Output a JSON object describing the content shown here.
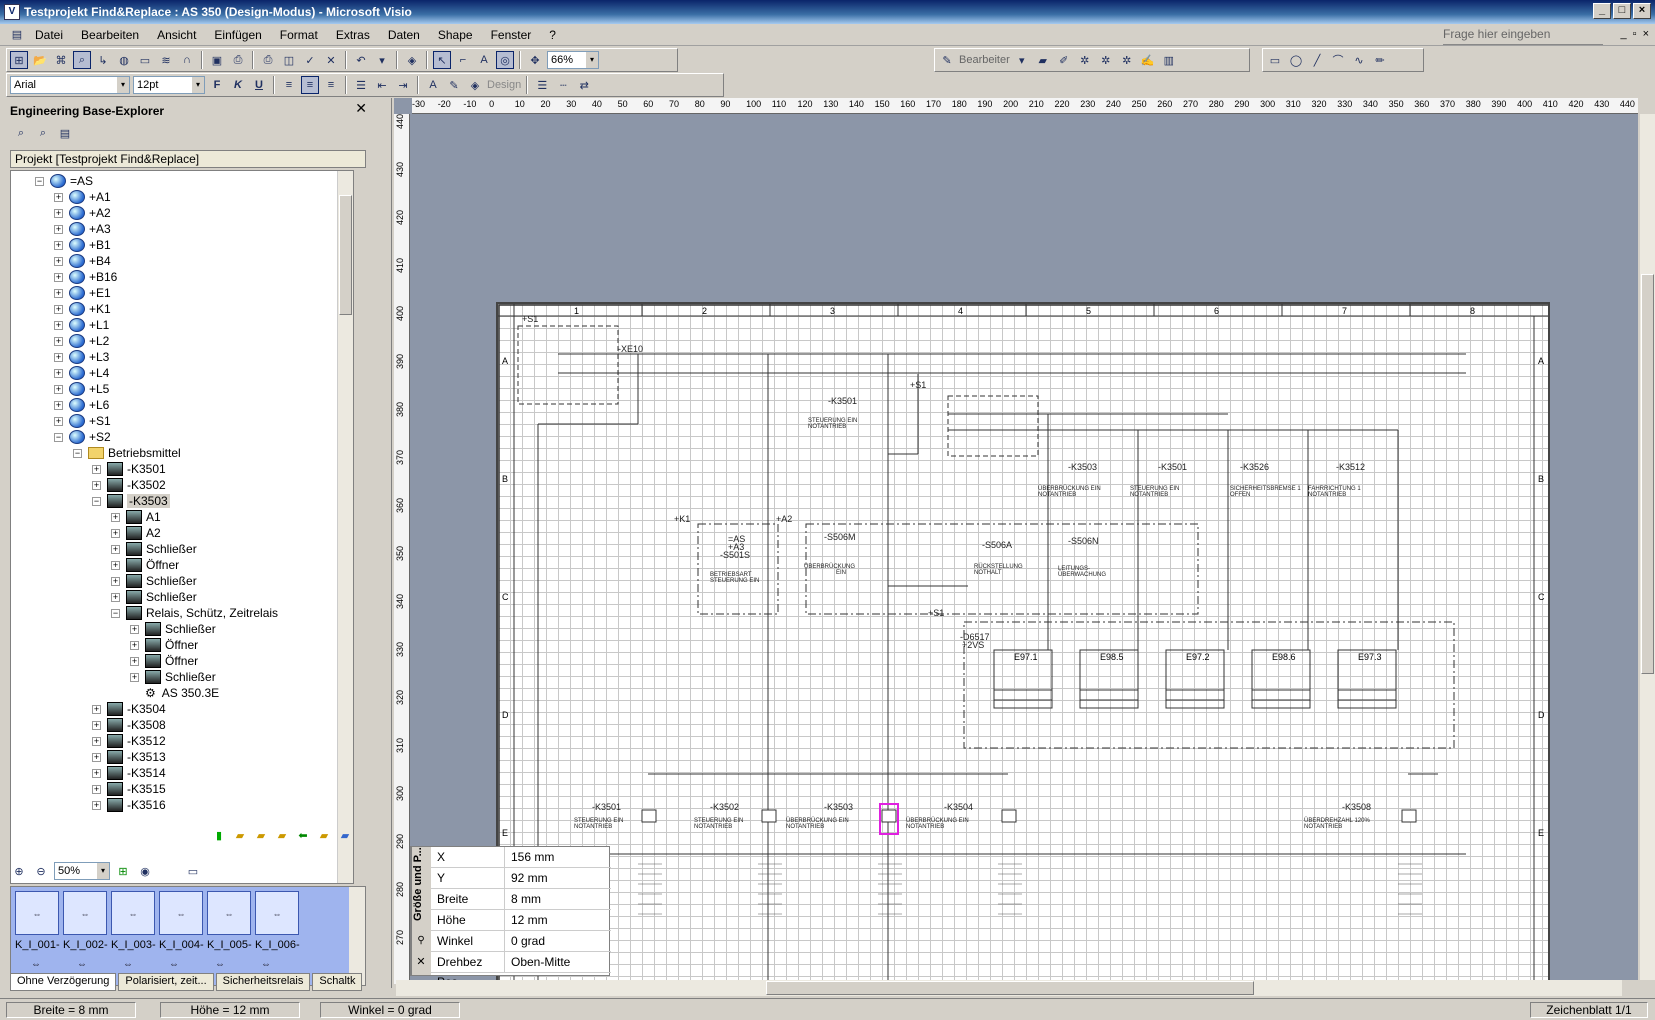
{
  "window": {
    "title": "Testprojekt Find&Replace : AS 350 (Design-Modus) - Microsoft Visio"
  },
  "menu": [
    "Datei",
    "Bearbeiten",
    "Ansicht",
    "Einfügen",
    "Format",
    "Extras",
    "Daten",
    "Shape",
    "Fenster",
    "?"
  ],
  "help_placeholder": "Frage hier eingeben",
  "toolbar": {
    "zoom": "66%",
    "font": "Arial",
    "size": "12pt",
    "bearbeiter": "Bearbeiter",
    "design": "Design"
  },
  "explorer": {
    "title": "Engineering Base-Explorer",
    "project": "Projekt [Testprojekt Find&Replace]",
    "tree": [
      {
        "label": "=AS",
        "level": 0,
        "icon": "globe",
        "exp": "-"
      },
      {
        "label": "+A1",
        "level": 1,
        "icon": "globe",
        "exp": "+"
      },
      {
        "label": "+A2",
        "level": 1,
        "icon": "globe",
        "exp": "+"
      },
      {
        "label": "+A3",
        "level": 1,
        "icon": "globe",
        "exp": "+"
      },
      {
        "label": "+B1",
        "level": 1,
        "icon": "globe",
        "exp": "+"
      },
      {
        "label": "+B4",
        "level": 1,
        "icon": "globe",
        "exp": "+"
      },
      {
        "label": "+B16",
        "level": 1,
        "icon": "globe",
        "exp": "+"
      },
      {
        "label": "+E1",
        "level": 1,
        "icon": "globe",
        "exp": "+"
      },
      {
        "label": "+K1",
        "level": 1,
        "icon": "globe",
        "exp": "+"
      },
      {
        "label": "+L1",
        "level": 1,
        "icon": "globe",
        "exp": "+"
      },
      {
        "label": "+L2",
        "level": 1,
        "icon": "globe",
        "exp": "+"
      },
      {
        "label": "+L3",
        "level": 1,
        "icon": "globe",
        "exp": "+"
      },
      {
        "label": "+L4",
        "level": 1,
        "icon": "globe",
        "exp": "+"
      },
      {
        "label": "+L5",
        "level": 1,
        "icon": "globe",
        "exp": "+"
      },
      {
        "label": "+L6",
        "level": 1,
        "icon": "globe",
        "exp": "+"
      },
      {
        "label": "+S1",
        "level": 1,
        "icon": "globe",
        "exp": "+"
      },
      {
        "label": "+S2",
        "level": 1,
        "icon": "globe",
        "exp": "-"
      },
      {
        "label": "Betriebsmittel",
        "level": 2,
        "icon": "folder",
        "exp": "-"
      },
      {
        "label": "-K3501",
        "level": 3,
        "icon": "device",
        "exp": "+"
      },
      {
        "label": "-K3502",
        "level": 3,
        "icon": "device",
        "exp": "+"
      },
      {
        "label": "-K3503",
        "level": 3,
        "icon": "device",
        "exp": "-",
        "selected": true
      },
      {
        "label": "A1",
        "level": 4,
        "icon": "device",
        "exp": "+"
      },
      {
        "label": "A2",
        "level": 4,
        "icon": "device",
        "exp": "+"
      },
      {
        "label": "Schließer",
        "level": 4,
        "icon": "device",
        "exp": "+"
      },
      {
        "label": "Öffner",
        "level": 4,
        "icon": "device",
        "exp": "+"
      },
      {
        "label": "Schließer",
        "level": 4,
        "icon": "device",
        "exp": "+"
      },
      {
        "label": "Schließer",
        "level": 4,
        "icon": "device",
        "exp": "+"
      },
      {
        "label": "Relais, Schütz, Zeitrelais",
        "level": 4,
        "icon": "device",
        "exp": "-"
      },
      {
        "label": "Schließer",
        "level": 5,
        "icon": "device",
        "exp": "+"
      },
      {
        "label": "Öffner",
        "level": 5,
        "icon": "device",
        "exp": "+"
      },
      {
        "label": "Öffner",
        "level": 5,
        "icon": "device",
        "exp": "+"
      },
      {
        "label": "Schließer",
        "level": 5,
        "icon": "device",
        "exp": "+"
      },
      {
        "label": "AS 350.3E",
        "level": 5,
        "icon": "sheet",
        "exp": ""
      },
      {
        "label": "-K3504",
        "level": 3,
        "icon": "device",
        "exp": "+"
      },
      {
        "label": "-K3508",
        "level": 3,
        "icon": "device",
        "exp": "+"
      },
      {
        "label": "-K3512",
        "level": 3,
        "icon": "device",
        "exp": "+"
      },
      {
        "label": "-K3513",
        "level": 3,
        "icon": "device",
        "exp": "+"
      },
      {
        "label": "-K3514",
        "level": 3,
        "icon": "device",
        "exp": "+"
      },
      {
        "label": "-K3515",
        "level": 3,
        "icon": "device",
        "exp": "+"
      },
      {
        "label": "-K3516",
        "level": 3,
        "icon": "device",
        "exp": "+"
      }
    ],
    "zoom": "50%",
    "stencils": [
      "K_I_001-",
      "K_I_002-",
      "K_I_003-",
      "K_I_004-",
      "K_I_005-",
      "K_I_006-"
    ],
    "tabs": [
      "Ohne Verzögerung",
      "Polarisiert, zeit...",
      "Sicherheitsrelais",
      "Schaltk"
    ]
  },
  "sizepos": {
    "title": "Größe und P...",
    "rows": [
      {
        "k": "X",
        "v": "156 mm"
      },
      {
        "k": "Y",
        "v": "92 mm"
      },
      {
        "k": "Breite",
        "v": "8 mm"
      },
      {
        "k": "Höhe",
        "v": "12 mm"
      },
      {
        "k": "Winkel",
        "v": "0 grad"
      },
      {
        "k": "Drehbez Pos",
        "v": "Oben-Mitte"
      }
    ]
  },
  "ruler_h": [
    "-30",
    "-20",
    "-10",
    "0",
    "10",
    "20",
    "30",
    "40",
    "50",
    "60",
    "70",
    "80",
    "90",
    "100",
    "110",
    "120",
    "130",
    "140",
    "150",
    "160",
    "170",
    "180",
    "190",
    "200",
    "210",
    "220",
    "230",
    "240",
    "250",
    "260",
    "270",
    "280",
    "290",
    "300",
    "310",
    "320",
    "330",
    "340",
    "350",
    "360",
    "370",
    "380",
    "390",
    "400",
    "410",
    "420",
    "430",
    "440"
  ],
  "ruler_v": [
    "270",
    "280",
    "290",
    "300",
    "310",
    "320",
    "330",
    "340",
    "350",
    "360",
    "370",
    "380",
    "390",
    "400",
    "410",
    "420",
    "430",
    "440"
  ],
  "drawing": {
    "cols": [
      "1",
      "2",
      "3",
      "4",
      "5",
      "6",
      "7",
      "8"
    ],
    "rows": [
      "A",
      "B",
      "C",
      "D",
      "E"
    ],
    "labels": [
      "+S1",
      "-XE10",
      "-K3501",
      "STEUERUNG EIN",
      "NOTANTRIEB",
      "+S1",
      "-K3503",
      "ÜBERBRÜCKUNG EIN",
      "NOTANTRIEB",
      "-K3501",
      "STEUERUNG EIN",
      "NOTANTRIEB",
      "-K3526",
      "SICHERHEITSBREMSE 1",
      "OFFEN",
      "-K3512",
      "FAHRRICHTUNG 1",
      "NOTANTRIEB",
      "+K1",
      "=AS",
      "+A3",
      "-S501S",
      "BETRIEBSART",
      "STEUERUNG EIN",
      "+A2",
      "-S506M",
      "ÜBERBRÜCKUNG",
      "EIN",
      "-S506A",
      "RÜCKSTELLUNG",
      "NOTHALT",
      "-S506N",
      "LEITUNGS-",
      "ÜBERWACHUNG",
      "+S1",
      "-D6517",
      "+2VS",
      "E97.1",
      "E98.5",
      "E97.2",
      "E98.6",
      "E97.3",
      "-K3501",
      "STEUERUNG EIN",
      "NOTANTRIEB",
      "-K3502",
      "STEUERUNG EIN",
      "NOTANTRIEB",
      "-K3503",
      "ÜBERBRÜCKUNG EIN",
      "NOTANTRIEB",
      "-K3504",
      "ÜBERBRÜCKUNG EIN",
      "NOTANTRIEB",
      "-K3508",
      "ÜBERDREHZAHL 120%",
      "NOTANTRIEB"
    ]
  },
  "status": {
    "breite": "Breite = 8 mm",
    "hoehe": "Höhe = 12 mm",
    "winkel": "Winkel = 0 grad",
    "sheet": "Zeichenblatt 1/1"
  }
}
